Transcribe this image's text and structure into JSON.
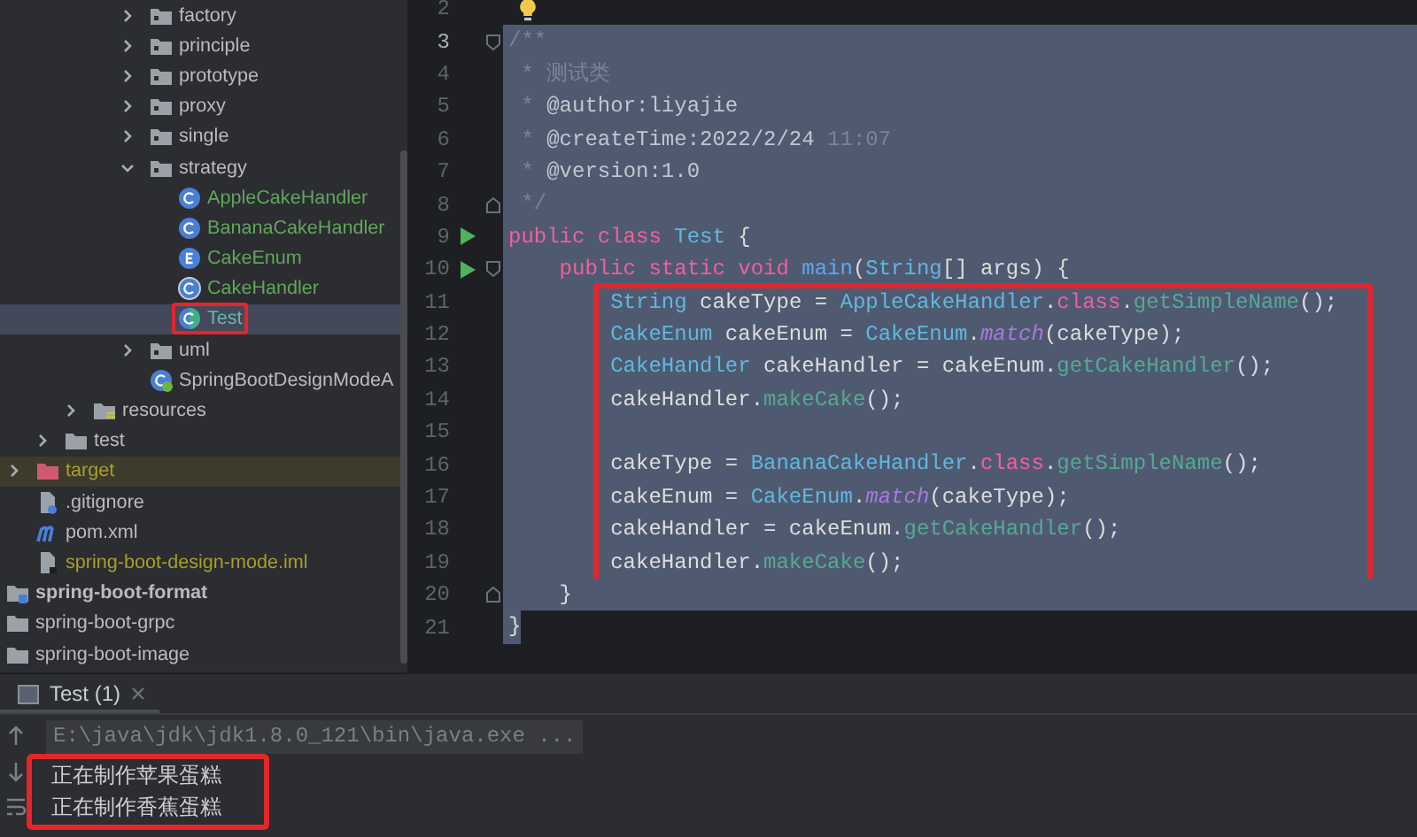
{
  "tree": {
    "items": [
      {
        "children": [
          {
            "children": [
              {
                "children": [
                  {
                    "children": [
                      {
                        "children": [
                          {
                            "label": "factory",
                            "kind": "package",
                            "expanded": false,
                            "selected": false,
                            "hovered": false,
                            "bold": false,
                            "outlined": false,
                            "color": "#bbbbbb"
                          },
                          {
                            "label": "principle",
                            "kind": "package",
                            "expanded": false,
                            "selected": false,
                            "hovered": false,
                            "bold": false,
                            "outlined": false,
                            "color": "#bbbbbb"
                          },
                          {
                            "label": "prototype",
                            "kind": "package",
                            "expanded": false,
                            "selected": false,
                            "hovered": false,
                            "bold": false,
                            "outlined": false,
                            "color": "#bbbbbb"
                          },
                          {
                            "label": "proxy",
                            "kind": "package",
                            "expanded": false,
                            "selected": false,
                            "hovered": false,
                            "bold": false,
                            "outlined": false,
                            "color": "#bbbbbb"
                          },
                          {
                            "label": "single",
                            "kind": "package",
                            "expanded": false,
                            "selected": false,
                            "hovered": false,
                            "bold": false,
                            "outlined": false,
                            "color": "#bbbbbb"
                          },
                          {
                            "label": "strategy",
                            "kind": "package",
                            "expanded": true,
                            "selected": false,
                            "hovered": false,
                            "bold": false,
                            "outlined": false,
                            "color": "#bbbbbb",
                            "children": [
                              {
                                "label": "AppleCakeHandler",
                                "kind": "class",
                                "selected": false,
                                "hovered": false,
                                "bold": false,
                                "outlined": false,
                                "color": "#62a65c"
                              },
                              {
                                "label": "BananaCakeHandler",
                                "kind": "class",
                                "selected": false,
                                "hovered": false,
                                "bold": false,
                                "outlined": false,
                                "color": "#62a65c"
                              },
                              {
                                "label": "CakeEnum",
                                "kind": "enum",
                                "selected": false,
                                "hovered": false,
                                "bold": false,
                                "outlined": false,
                                "color": "#62a65c"
                              },
                              {
                                "label": "CakeHandler",
                                "kind": "abstract",
                                "selected": false,
                                "hovered": false,
                                "bold": false,
                                "outlined": false,
                                "color": "#62a65c"
                              },
                              {
                                "label": "Test",
                                "kind": "test",
                                "selected": true,
                                "hovered": false,
                                "bold": false,
                                "outlined": true,
                                "color": "#6cb5a6"
                              }
                            ]
                          },
                          {
                            "label": "uml",
                            "kind": "package",
                            "expanded": false,
                            "selected": false,
                            "hovered": false,
                            "bold": false,
                            "outlined": false,
                            "color": "#bbbbbb"
                          },
                          {
                            "label": "SpringBootDesignModeA",
                            "kind": "spring",
                            "selected": false,
                            "hovered": false,
                            "bold": false,
                            "outlined": false,
                            "color": "#bbbbbb"
                          }
                        ]
                      }
                    ]
                  },
                  {
                    "label": "resources",
                    "kind": "resources",
                    "expanded": false,
                    "selected": false,
                    "hovered": false,
                    "bold": false,
                    "outlined": false,
                    "color": "#bbbbbb"
                  }
                ]
              },
              {
                "label": "test",
                "kind": "folder",
                "expanded": false,
                "selected": false,
                "hovered": false,
                "bold": false,
                "outlined": false,
                "color": "#bbbbbb"
              }
            ]
          },
          {
            "label": "target",
            "kind": "target",
            "expanded": false,
            "selected": false,
            "hovered": true,
            "bold": false,
            "outlined": false,
            "color": "#a89e2c"
          },
          {
            "label": ".gitignore",
            "kind": "gitignore",
            "selected": false,
            "hovered": false,
            "bold": false,
            "outlined": false,
            "color": "#bbbbbb"
          },
          {
            "label": "pom.xml",
            "kind": "maven",
            "selected": false,
            "hovered": false,
            "bold": false,
            "outlined": false,
            "color": "#bbbbbb"
          },
          {
            "label": "spring-boot-design-mode.iml",
            "kind": "iml",
            "selected": false,
            "hovered": false,
            "bold": false,
            "outlined": false,
            "color": "#a89e2c"
          }
        ]
      },
      {
        "label": "spring-boot-format",
        "kind": "module",
        "selected": false,
        "hovered": false,
        "bold": true,
        "outlined": false,
        "color": "#bbbbbb"
      },
      {
        "label": "spring-boot-grpc",
        "kind": "folder-plain",
        "selected": false,
        "hovered": false,
        "bold": false,
        "outlined": false,
        "color": "#bbbbbb"
      },
      {
        "label": "spring-boot-image",
        "kind": "folder-plain",
        "selected": false,
        "hovered": false,
        "bold": false,
        "outlined": false,
        "color": "#bbbbbb"
      }
    ]
  },
  "editor": {
    "blocks": [
      {
        "boxed": false,
        "lines": [
          {
            "number": "2",
            "current": false,
            "run": false,
            "fold_open": false,
            "fold_close": false,
            "bulb": true,
            "selected": false
          },
          {
            "number": "3",
            "current": true,
            "run": false,
            "fold_open": true,
            "fold_close": false,
            "bulb": false,
            "selected": true,
            "tokens": [
              {
                "text": "/**",
                "kind": "comment"
              }
            ]
          },
          {
            "number": "4",
            "current": false,
            "run": false,
            "fold_open": false,
            "fold_close": false,
            "bulb": false,
            "selected": true,
            "tokens": [
              {
                "text": " * 测试类",
                "kind": "comment"
              }
            ]
          },
          {
            "number": "5",
            "current": false,
            "run": false,
            "fold_open": false,
            "fold_close": false,
            "bulb": false,
            "selected": true,
            "tokens": [
              {
                "text": " *",
                "kind": "comment"
              },
              {
                "text": " @author:liyajie",
                "kind": "doc"
              }
            ]
          },
          {
            "number": "6",
            "current": false,
            "run": false,
            "fold_open": false,
            "fold_close": false,
            "bulb": false,
            "selected": true,
            "tokens": [
              {
                "text": " *",
                "kind": "comment"
              },
              {
                "text": " @createTime:2022/2/24",
                "kind": "doc"
              },
              {
                "text": " 11:07",
                "kind": "comment"
              }
            ]
          },
          {
            "number": "7",
            "current": false,
            "run": false,
            "fold_open": false,
            "fold_close": false,
            "bulb": false,
            "selected": true,
            "tokens": [
              {
                "text": " *",
                "kind": "comment"
              },
              {
                "text": " @version:1.0",
                "kind": "doc"
              }
            ]
          },
          {
            "number": "8",
            "current": false,
            "run": false,
            "fold_open": false,
            "fold_close": true,
            "bulb": false,
            "selected": true,
            "tokens": [
              {
                "text": " */",
                "kind": "comment"
              }
            ]
          },
          {
            "number": "9",
            "current": false,
            "run": true,
            "fold_open": false,
            "fold_close": false,
            "bulb": false,
            "selected": true,
            "tokens": [
              {
                "text": "public class",
                "kind": "keyword"
              },
              {
                "text": " Test",
                "kind": "type"
              },
              {
                "text": " {",
                "kind": "plain"
              }
            ]
          },
          {
            "number": "10",
            "current": false,
            "run": true,
            "fold_open": true,
            "fold_close": false,
            "bulb": false,
            "selected": true,
            "tokens": [
              {
                "text": "    public static void",
                "kind": "keyword"
              },
              {
                "text": " main",
                "kind": "decl"
              },
              {
                "text": "(",
                "kind": "plain"
              },
              {
                "text": "String",
                "kind": "type"
              },
              {
                "text": "[] args) {",
                "kind": "plain"
              }
            ]
          }
        ]
      },
      {
        "boxed": true,
        "lines": [
          {
            "number": "11",
            "current": false,
            "run": false,
            "fold_open": false,
            "fold_close": false,
            "bulb": false,
            "selected": true,
            "tokens": [
              {
                "text": "        String",
                "kind": "type"
              },
              {
                "text": " cakeType = ",
                "kind": "plain"
              },
              {
                "text": "AppleCakeHandler",
                "kind": "type"
              },
              {
                "text": ".",
                "kind": "plain"
              },
              {
                "text": "class",
                "kind": "keyword"
              },
              {
                "text": ".",
                "kind": "plain"
              },
              {
                "text": "getSimpleName",
                "kind": "call"
              },
              {
                "text": "();",
                "kind": "plain"
              }
            ]
          },
          {
            "number": "12",
            "current": false,
            "run": false,
            "fold_open": false,
            "fold_close": false,
            "bulb": false,
            "selected": true,
            "tokens": [
              {
                "text": "        CakeEnum",
                "kind": "type"
              },
              {
                "text": " cakeEnum = ",
                "kind": "plain"
              },
              {
                "text": "CakeEnum",
                "kind": "type"
              },
              {
                "text": ".",
                "kind": "plain"
              },
              {
                "text": "match",
                "kind": "static"
              },
              {
                "text": "(cakeType);",
                "kind": "plain"
              }
            ]
          },
          {
            "number": "13",
            "current": false,
            "run": false,
            "fold_open": false,
            "fold_close": false,
            "bulb": false,
            "selected": true,
            "tokens": [
              {
                "text": "        CakeHandler",
                "kind": "type"
              },
              {
                "text": " cakeHandler = cakeEnum.",
                "kind": "plain"
              },
              {
                "text": "getCakeHandler",
                "kind": "call"
              },
              {
                "text": "();",
                "kind": "plain"
              }
            ]
          },
          {
            "number": "14",
            "current": false,
            "run": false,
            "fold_open": false,
            "fold_close": false,
            "bulb": false,
            "selected": true,
            "tokens": [
              {
                "text": "        cakeHandler.",
                "kind": "plain"
              },
              {
                "text": "makeCake",
                "kind": "call"
              },
              {
                "text": "();",
                "kind": "plain"
              }
            ]
          },
          {
            "number": "15",
            "current": false,
            "run": false,
            "fold_open": false,
            "fold_close": false,
            "bulb": false,
            "selected": true
          },
          {
            "number": "16",
            "current": false,
            "run": false,
            "fold_open": false,
            "fold_close": false,
            "bulb": false,
            "selected": true,
            "tokens": [
              {
                "text": "        cakeType = ",
                "kind": "plain"
              },
              {
                "text": "BananaCakeHandler",
                "kind": "type"
              },
              {
                "text": ".",
                "kind": "plain"
              },
              {
                "text": "class",
                "kind": "keyword"
              },
              {
                "text": ".",
                "kind": "plain"
              },
              {
                "text": "getSimpleName",
                "kind": "call"
              },
              {
                "text": "();",
                "kind": "plain"
              }
            ]
          },
          {
            "number": "17",
            "current": false,
            "run": false,
            "fold_open": false,
            "fold_close": false,
            "bulb": false,
            "selected": true,
            "tokens": [
              {
                "text": "        cakeEnum = ",
                "kind": "plain"
              },
              {
                "text": "CakeEnum",
                "kind": "type"
              },
              {
                "text": ".",
                "kind": "plain"
              },
              {
                "text": "match",
                "kind": "static"
              },
              {
                "text": "(cakeType);",
                "kind": "plain"
              }
            ]
          },
          {
            "number": "18",
            "current": false,
            "run": false,
            "fold_open": false,
            "fold_close": false,
            "bulb": false,
            "selected": true,
            "tokens": [
              {
                "text": "        cakeHandler = cakeEnum.",
                "kind": "plain"
              },
              {
                "text": "getCakeHandler",
                "kind": "call"
              },
              {
                "text": "();",
                "kind": "plain"
              }
            ]
          },
          {
            "number": "19",
            "current": false,
            "run": false,
            "fold_open": false,
            "fold_close": false,
            "bulb": false,
            "selected": true,
            "tokens": [
              {
                "text": "        cakeHandler.",
                "kind": "plain"
              },
              {
                "text": "makeCake",
                "kind": "call"
              },
              {
                "text": "();",
                "kind": "plain"
              }
            ]
          }
        ]
      },
      {
        "boxed": false,
        "lines": [
          {
            "number": "20",
            "current": false,
            "run": false,
            "fold_open": false,
            "fold_close": true,
            "bulb": false,
            "selected": true,
            "tokens": [
              {
                "text": "    }",
                "kind": "plain"
              }
            ]
          },
          {
            "number": "21",
            "current": false,
            "run": false,
            "fold_open": false,
            "fold_close": false,
            "bulb": false,
            "selected": true,
            "tokens": [
              {
                "text": "}",
                "kind": "plain"
              }
            ]
          }
        ]
      }
    ]
  },
  "run_panel": {
    "tab": {
      "label": "Test (1)",
      "selected": true
    },
    "blocks": [
      {
        "boxed": false,
        "lines": [
          {
            "text": "E:\\java\\jdk\\jdk1.8.0_121\\bin\\java.exe ...",
            "kind": "command"
          }
        ]
      },
      {
        "boxed": true,
        "lines": [
          {
            "text": "正在制作苹果蛋糕",
            "kind": "output"
          },
          {
            "text": "正在制作香蕉蛋糕",
            "kind": "output"
          }
        ]
      }
    ]
  }
}
